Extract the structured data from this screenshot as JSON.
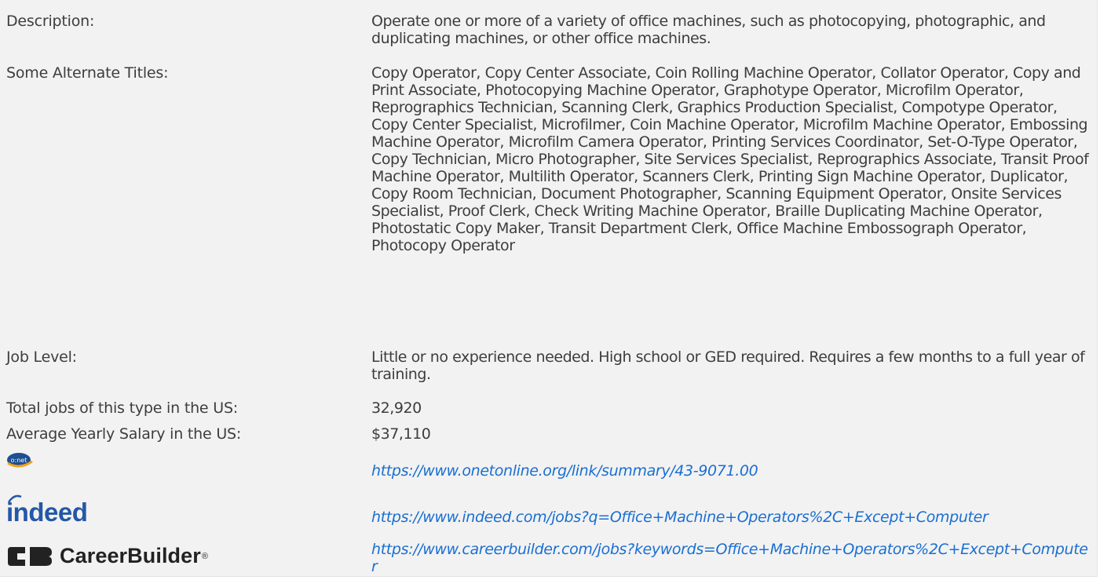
{
  "fields": {
    "description": {
      "label": "Description:",
      "value": "Operate one or more of a variety of office machines, such as photocopying, photographic, and duplicating machines, or other office machines."
    },
    "alternate_titles": {
      "label": "Some Alternate Titles:",
      "value": "Copy Operator, Copy Center Associate, Coin Rolling Machine Operator, Collator Operator, Copy and Print Associate, Photocopying Machine Operator, Graphotype Operator, Microfilm Operator, Reprographics Technician, Scanning Clerk, Graphics Production Specialist, Compotype Operator, Copy Center Specialist, Microfilmer, Coin Machine Operator, Microfilm Machine Operator, Embossing Machine Operator, Microfilm Camera Operator, Printing Services Coordinator, Set-O-Type Operator, Copy Technician, Micro Photographer, Site Services Specialist, Reprographics Associate, Transit Proof Machine Operator, Multilith Operator, Scanners Clerk, Printing Sign Machine Operator, Duplicator, Copy Room Technician, Document Photographer, Scanning Equipment Operator, Onsite Services Specialist, Proof Clerk, Check Writing Machine Operator, Braille Duplicating Machine Operator, Photostatic Copy Maker, Transit Department Clerk, Office Machine Embossograph Operator, Photocopy Operator"
    },
    "job_level": {
      "label": "Job Level:",
      "value": "Little or no experience needed. High school or GED required. Requires a few months to a full year of training."
    },
    "total_jobs": {
      "label": "Total jobs of this type in the US:",
      "value": "32,920"
    },
    "salary": {
      "label": "Average Yearly Salary in the US:",
      "value": "$37,110"
    }
  },
  "links": {
    "onet": {
      "logo_text": "o:net",
      "url": "https://www.onetonline.org/link/summary/43-9071.00"
    },
    "indeed": {
      "logo_text": "indeed",
      "url": "https://www.indeed.com/jobs?q=Office+Machine+Operators%2C+Except+Computer"
    },
    "careerbuilder": {
      "logo_text": "CareerBuilder",
      "logo_mark": "®",
      "url": "https://www.careerbuilder.com/jobs?keywords=Office+Machine+Operators%2C+Except+Computer"
    }
  },
  "colors": {
    "background": "#f2f2f2",
    "text": "#3d3d3d",
    "link": "#1a6fd1",
    "indeed_blue": "#2557a7",
    "onet_blue": "#1d4f91",
    "onet_orange": "#f4a11a"
  },
  "icons": [
    "onet-logo-icon",
    "indeed-logo-icon",
    "careerbuilder-logo-icon"
  ]
}
